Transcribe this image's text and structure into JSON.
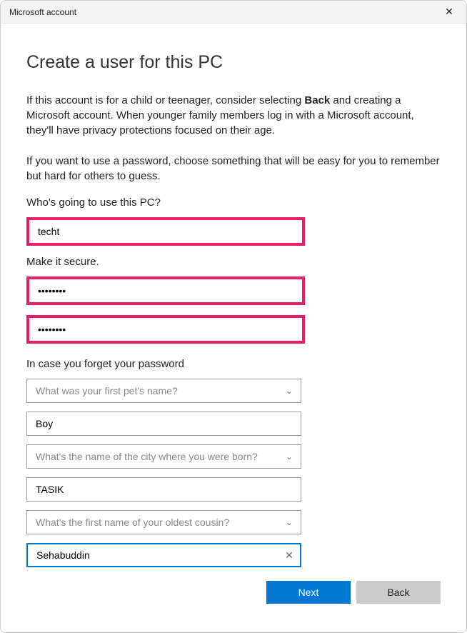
{
  "window": {
    "title": "Microsoft account"
  },
  "heading": "Create a user for this PC",
  "para1_pre": "If this account is for a child or teenager, consider selecting ",
  "para1_bold": "Back",
  "para1_post": " and creating a Microsoft account. When younger family members log in with a Microsoft account, they'll have privacy protections focused on their age.",
  "para2": "If you want to use a password, choose something that will be easy for you to remember but hard for others to guess.",
  "labels": {
    "who": "Who's going to use this PC?",
    "secure": "Make it secure.",
    "forgot": "In case you forget your password"
  },
  "fields": {
    "username": "techt",
    "password": "••••••••",
    "confirm": "••••••••",
    "answer1": "Boy",
    "answer2": "TASIK",
    "answer3": "Sehabuddin"
  },
  "selects": {
    "q1": "What was your first pet's name?",
    "q2": "What's the name of the city where you were born?",
    "q3": "What's the first name of your oldest cousin?"
  },
  "buttons": {
    "next": "Next",
    "back": "Back"
  }
}
